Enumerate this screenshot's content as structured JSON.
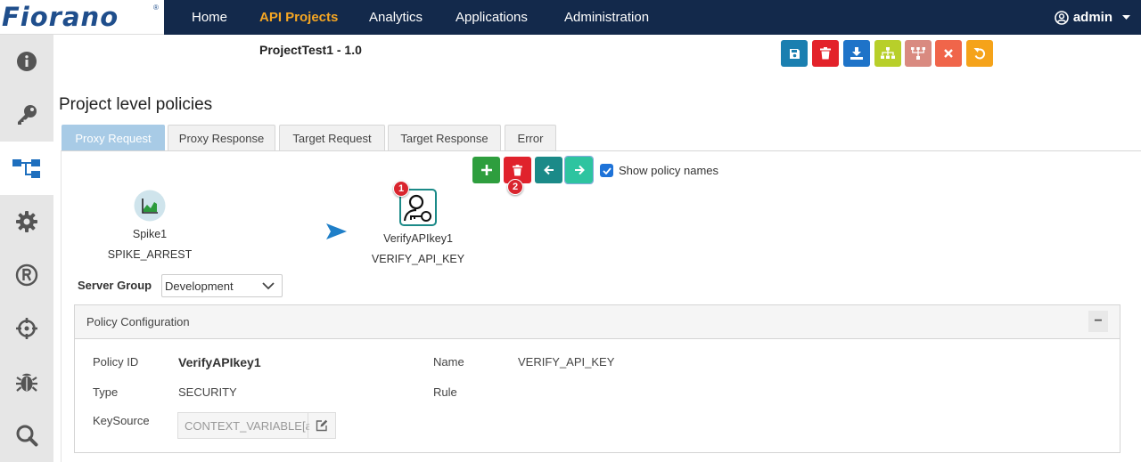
{
  "app": {
    "logo_text": "Fiorano",
    "logo_mark": "®"
  },
  "nav": {
    "items": [
      {
        "label": "Home"
      },
      {
        "label": "API Projects"
      },
      {
        "label": "Analytics"
      },
      {
        "label": "Applications"
      },
      {
        "label": "Administration"
      }
    ],
    "user": "admin"
  },
  "sidebar": {
    "items": [
      {
        "icon": "info-icon"
      },
      {
        "icon": "key-icon"
      },
      {
        "icon": "flow-icon"
      },
      {
        "icon": "gear-icon"
      },
      {
        "icon": "registered-icon"
      },
      {
        "icon": "crosshair-icon"
      },
      {
        "icon": "bug-icon"
      },
      {
        "icon": "search-icon"
      }
    ]
  },
  "project": {
    "title": "ProjectTest1 - 1.0"
  },
  "toolbar": {
    "buttons": [
      {
        "icon": "save-icon",
        "color": "#1a7fb0"
      },
      {
        "icon": "trash-icon",
        "color": "#e3222a"
      },
      {
        "icon": "download-icon",
        "color": "#1e73c8"
      },
      {
        "icon": "sitemap-icon",
        "color": "#b8cf2a"
      },
      {
        "icon": "hierarchy-icon",
        "color": "#d98a80"
      },
      {
        "icon": "close-icon",
        "color": "#f0654a"
      },
      {
        "icon": "undo-icon",
        "color": "#f5a31a"
      }
    ]
  },
  "section": {
    "title": "Project level policies"
  },
  "tabs": [
    {
      "label": "Proxy Request"
    },
    {
      "label": "Proxy Response"
    },
    {
      "label": "Target Request"
    },
    {
      "label": "Target Response"
    },
    {
      "label": "Error"
    }
  ],
  "policy_toolbar": {
    "show_names_label": "Show policy names",
    "show_names_checked": true,
    "colors": {
      "add": "#2e9e3e",
      "delete": "#e0222c",
      "left": "#1b8a88",
      "right": "#2ec4a0"
    }
  },
  "flow": {
    "nodes": [
      {
        "name": "Spike1",
        "type": "SPIKE_ARREST",
        "icon": "chart-area-icon"
      },
      {
        "name": "VerifyAPIkey1",
        "type": "VERIFY_API_KEY",
        "icon": "user-key-icon"
      }
    ],
    "badges": [
      "1",
      "2"
    ]
  },
  "server_group": {
    "label": "Server Group",
    "value": "Development"
  },
  "config": {
    "title": "Policy Configuration",
    "collapse": "−",
    "fields": {
      "policy_id_label": "Policy ID",
      "policy_id": "VerifyAPIkey1",
      "name_label": "Name",
      "name": "VERIFY_API_KEY",
      "type_label": "Type",
      "type": "SECURITY",
      "rule_label": "Rule",
      "keysource_label": "KeySource",
      "keysource": "CONTEXT_VARIABLE[ap"
    }
  }
}
